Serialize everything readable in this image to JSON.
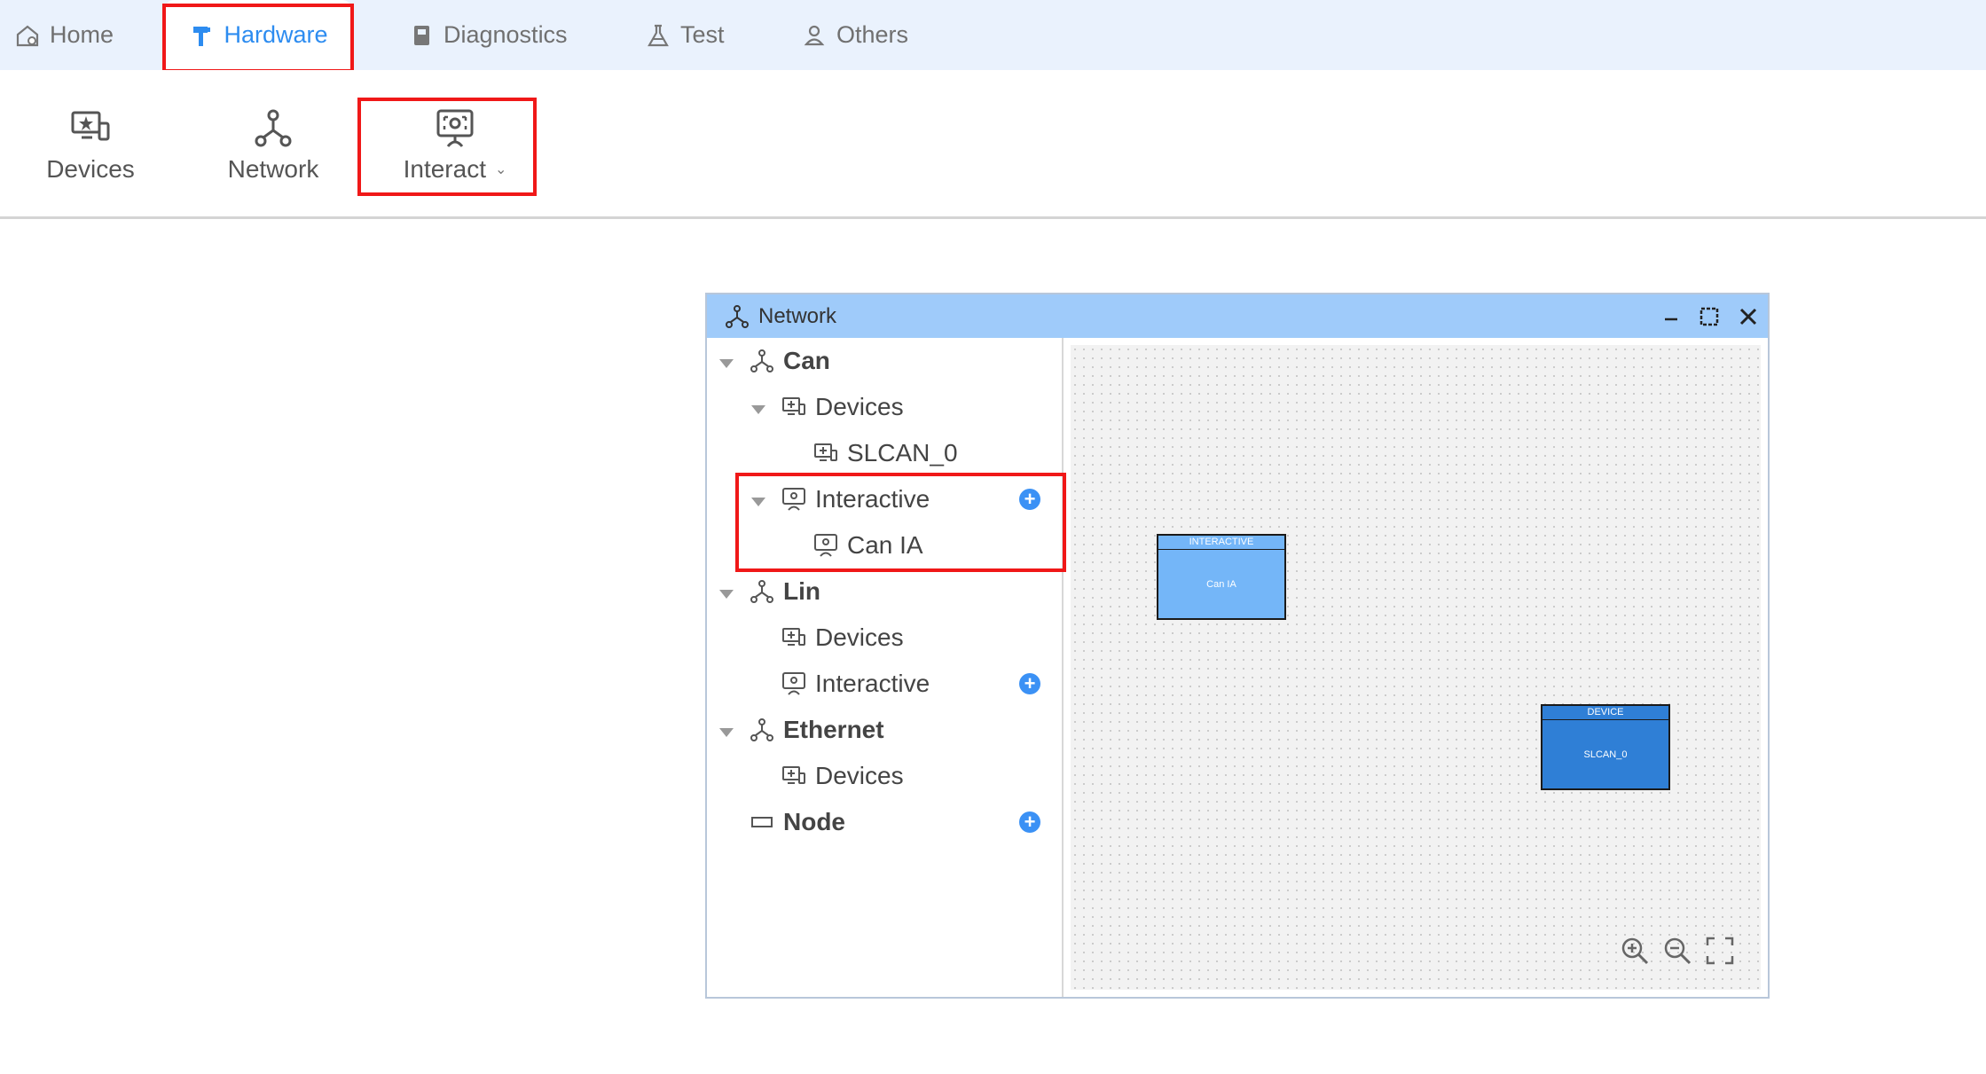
{
  "menu": {
    "tabs": [
      {
        "label": "Home",
        "icon": "home-icon"
      },
      {
        "label": "Hardware",
        "icon": "hammer-icon",
        "active": true
      },
      {
        "label": "Diagnostics",
        "icon": "book-icon"
      },
      {
        "label": "Test",
        "icon": "flask-icon"
      },
      {
        "label": "Others",
        "icon": "user-icon"
      }
    ]
  },
  "ribbon": {
    "devices_label": "Devices",
    "network_label": "Network",
    "interact_label": "Interact"
  },
  "window": {
    "title": "Network",
    "tree": {
      "can": "Can",
      "can_devices": "Devices",
      "slcan": "SLCAN_0",
      "can_interactive": "Interactive",
      "can_ia": "Can IA",
      "lin": "Lin",
      "lin_devices": "Devices",
      "lin_interactive": "Interactive",
      "ethernet": "Ethernet",
      "eth_devices": "Devices",
      "node": "Node"
    },
    "canvas": {
      "interactive_block": {
        "header": "INTERACTIVE",
        "label": "Can IA",
        "color": "#74b6f8"
      },
      "device_block": {
        "header": "DEVICE",
        "label": "SLCAN_0",
        "color": "#2f7fd6"
      }
    }
  },
  "colors": {
    "accent": "#2d8cf0",
    "highlight": "#f01818",
    "titlebar": "#9fcbfa"
  }
}
